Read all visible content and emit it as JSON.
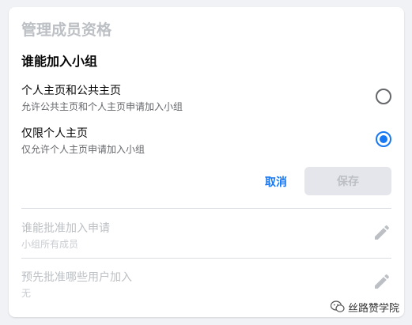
{
  "card": {
    "title": "管理成员资格",
    "section_title": "谁能加入小组",
    "options": [
      {
        "label": "个人主页和公共主页",
        "desc": "允许公共主页和个人主页申请加入小组",
        "checked": false
      },
      {
        "label": "仅限个人主页",
        "desc": "仅允许个人主页申请加入小组",
        "checked": true
      }
    ],
    "actions": {
      "cancel_label": "取消",
      "save_label": "保存"
    },
    "settings": [
      {
        "label": "谁能批准加入申请",
        "value": "小组所有成员",
        "icon": "pencil-icon"
      },
      {
        "label": "预先批准哪些用户加入",
        "value": "无",
        "icon": "pencil-icon"
      }
    ]
  },
  "watermark": {
    "text": "丝路赞学院"
  },
  "colors": {
    "accent": "#1877f2",
    "disabled_text": "#bcc0c4",
    "disabled_bg": "#e4e6eb"
  }
}
